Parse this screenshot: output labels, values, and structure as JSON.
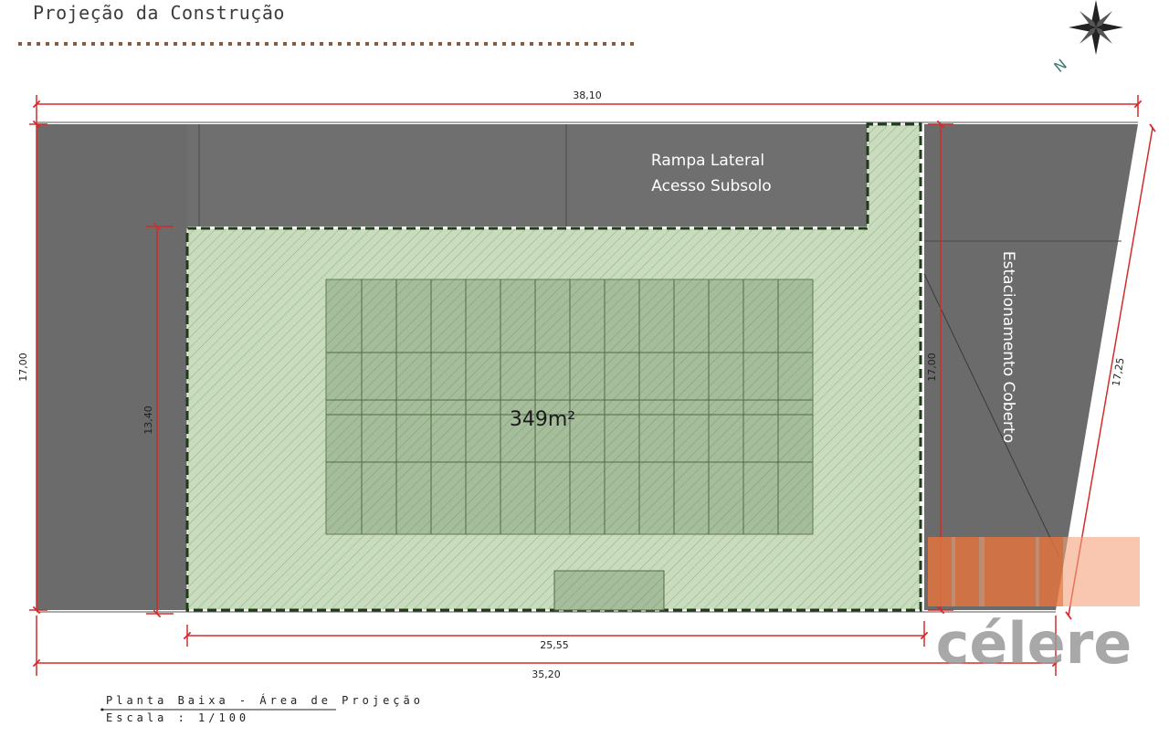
{
  "title": "Projeção da Construção",
  "labels": {
    "ramp": [
      "Rampa Lateral",
      "Acesso Subsolo"
    ],
    "parking": "Estacionamento Coberto",
    "area": "349m²",
    "north": "N"
  },
  "dimensions": {
    "top_width": "38,10",
    "left_height": "17,00",
    "inner_height": "13,40",
    "right_inner_height": "17,00",
    "diagonal_side": "17,25",
    "building_width": "25,55",
    "bottom_width": "35,20"
  },
  "caption": {
    "line1": "Planta Baixa - Área de Projeção",
    "line2": "Escala : 1/100"
  },
  "watermark": "célere",
  "colors": {
    "pavement": "#6b6b6b",
    "building": "#c8dcbd",
    "dimension": "#d42b2b",
    "watermark_orange": "#f07a40",
    "watermark_gray": "#9a9a9a"
  }
}
